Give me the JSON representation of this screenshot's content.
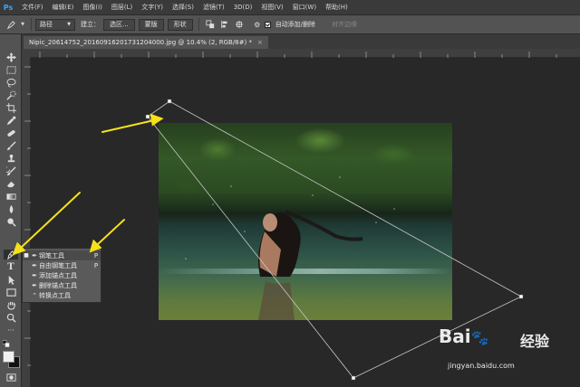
{
  "app": {
    "logo": "Ps"
  },
  "menubar": {
    "items": [
      "文件(F)",
      "编辑(E)",
      "图像(I)",
      "图层(L)",
      "文字(Y)",
      "选择(S)",
      "滤镜(T)",
      "3D(D)",
      "视图(V)",
      "窗口(W)",
      "帮助(H)"
    ]
  },
  "options": {
    "mode": "路径",
    "build_label": "建立：",
    "selection_btn": "选区...",
    "mask_btn": "蒙版",
    "shape_btn": "形状",
    "auto_add_delete": "自动添加/删除",
    "align_edges": "对齐边缘"
  },
  "document": {
    "tab_title": "Nipic_20614752_20160916201731204000.jpg @ 10.4% (2, RGB/8#) *",
    "close_glyph": "×"
  },
  "tool_flyout": {
    "items": [
      {
        "label": "钢笔工具",
        "key": "P",
        "icon": "pen-icon",
        "active": true
      },
      {
        "label": "自由钢笔工具",
        "key": "P",
        "icon": "freeform-pen-icon",
        "active": false
      },
      {
        "label": "添加锚点工具",
        "key": "",
        "icon": "add-anchor-icon",
        "active": false
      },
      {
        "label": "删除锚点工具",
        "key": "",
        "icon": "delete-anchor-icon",
        "active": false
      },
      {
        "label": "转换点工具",
        "key": "",
        "icon": "convert-point-icon",
        "active": false
      }
    ]
  },
  "watermark": {
    "logo": "Bai",
    "paw": "du",
    "cn": "经验",
    "url": "jingyan.baidu.com"
  },
  "colors": {
    "menubar": "#3a3a3a",
    "toolbar": "#535353",
    "canvas": "#282828",
    "arrow": "#f5e11a",
    "accent": "#31a8ff"
  }
}
